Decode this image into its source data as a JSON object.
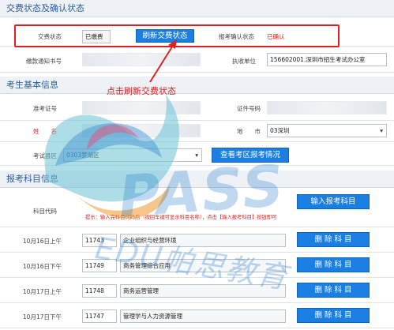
{
  "fee_section": {
    "title": "交费状态及确认状态",
    "fee_status_label": "交费状态",
    "fee_status_value": "已缴费",
    "refresh_button": "刷新交费状态",
    "confirm_status_label": "报考确认状态",
    "confirm_status_value": "已确认",
    "notice_no_label": "缴款通知书号",
    "notice_no_value": "",
    "exec_unit_label": "执收单位",
    "exec_unit_value": "156602001.深圳市招生考试办公室",
    "annotation": "点击刷新交费状态"
  },
  "basic_section": {
    "title": "考生基本信息",
    "admission_label": "准考证号",
    "admission_value": "",
    "id_label": "证件号码",
    "id_value": "",
    "name_label": "姓　　名",
    "name_value": "",
    "city_label": "地　　市",
    "city_value": "03深圳",
    "district_label": "考试县区",
    "district_value": "0303罗湖区",
    "view_button": "查看考区报考情况"
  },
  "subject_section": {
    "title": "报考科目信息",
    "code_label": "科目代码",
    "input_button": "输入报考科目",
    "hint": "提示：输入完科目代码后（按回车键可显示科目名称），点击【输入报考科目】按钮即可",
    "delete_label": "删 除 科 目",
    "rows": [
      {
        "time": "10月16日上午",
        "code": "11743",
        "name": "企业组织与经营环境"
      },
      {
        "time": "10月16日下午",
        "code": "11749",
        "name": "商务管理综合应用"
      },
      {
        "time": "10月17日上午",
        "code": "11748",
        "name": "商务运营管理"
      },
      {
        "time": "10月17日下午",
        "code": "11747",
        "name": "管理学与人力资源管理"
      }
    ]
  },
  "watermark": {
    "brand": "PASS",
    "sub": "EDU帕思教育"
  }
}
